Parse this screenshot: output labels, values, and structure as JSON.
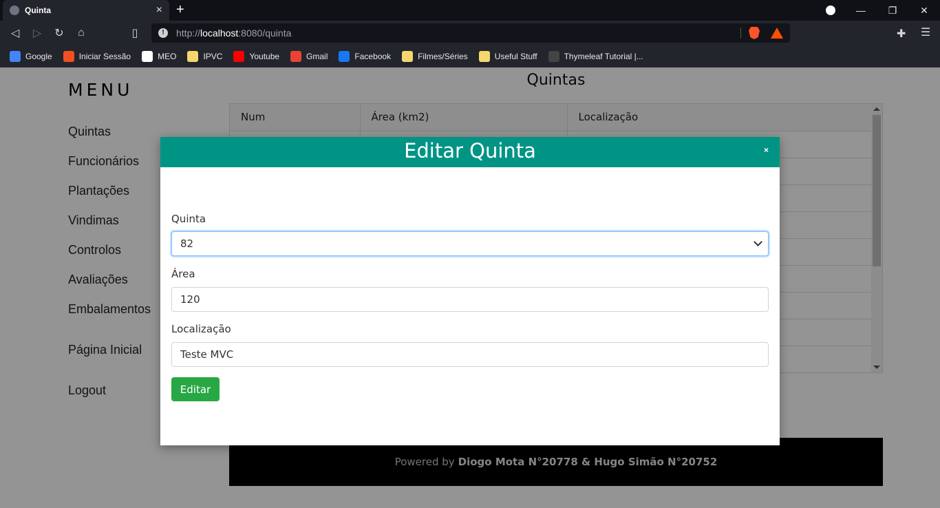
{
  "browser": {
    "tab_title": "Quinta",
    "tab_close": "×",
    "new_tab": "+",
    "url_prefix": "http://",
    "url_host": "localhost",
    "url_rest": ":8080/quinta",
    "window_controls": [
      "—",
      "❐",
      "✕"
    ],
    "bookmarks": [
      {
        "label": "Google",
        "icon": "google-icon",
        "color": "#4285f4"
      },
      {
        "label": "Iniciar Sessão",
        "icon": "microsoft-icon",
        "color": "#f25022"
      },
      {
        "label": "MEO",
        "icon": "meo-icon",
        "color": "#ffffff"
      },
      {
        "label": "IPVC",
        "icon": "folder-icon",
        "color": "#f5d76e"
      },
      {
        "label": "Youtube",
        "icon": "youtube-icon",
        "color": "#ff0000"
      },
      {
        "label": "Gmail",
        "icon": "gmail-icon",
        "color": "#ea4335"
      },
      {
        "label": "Facebook",
        "icon": "facebook-icon",
        "color": "#1877f2"
      },
      {
        "label": "Filmes/Séries",
        "icon": "folder-icon",
        "color": "#f5d76e"
      },
      {
        "label": "Useful Stuff",
        "icon": "folder-icon",
        "color": "#f5d76e"
      },
      {
        "label": "Thymeleaf Tutorial |...",
        "icon": "thymeleaf-icon",
        "color": "#444444"
      }
    ]
  },
  "sidebar": {
    "title": "MENU",
    "items": [
      "Quintas",
      "Funcionários",
      "Plantações",
      "Vindimas",
      "Controlos",
      "Avaliações",
      "Embalamentos"
    ],
    "home": "Página Inicial",
    "logout": "Logout"
  },
  "main": {
    "title": "Quintas",
    "columns": [
      "Num",
      "Área (km2)",
      "Localização"
    ]
  },
  "footer": {
    "prefix": "Powered by",
    "authors": "Diogo Mota N°20778 & Hugo Simão N°20752"
  },
  "modal": {
    "title": "Editar Quinta",
    "close": "×",
    "quinta_label": "Quinta",
    "quinta_value": "82",
    "area_label": "Área",
    "area_value": "120",
    "local_label": "Localização",
    "local_value": "Teste MVC",
    "submit": "Editar"
  }
}
